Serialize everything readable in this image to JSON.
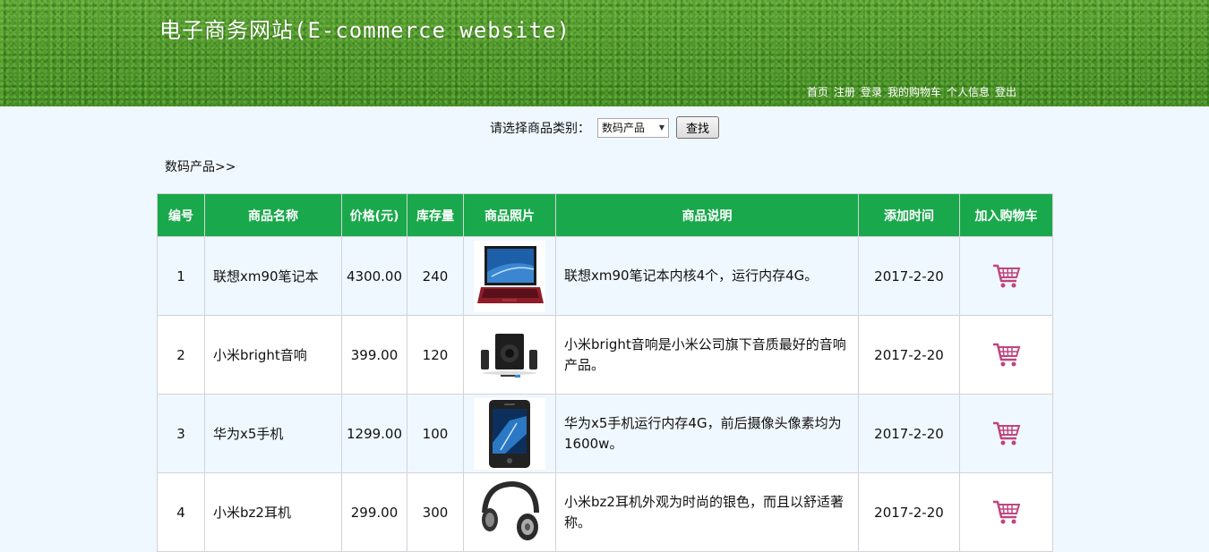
{
  "header": {
    "title": "电子商务网站(E-commerce website)",
    "nav": [
      "首页",
      "注册",
      "登录",
      "我的购物车",
      "个人信息",
      "登出"
    ]
  },
  "filter": {
    "label": "请选择商品类别：",
    "selected": "数码产品",
    "button": "查找"
  },
  "breadcrumb": "数码产品>>",
  "table": {
    "headers": [
      "编号",
      "商品名称",
      "价格(元)",
      "库存量",
      "商品照片",
      "商品说明",
      "添加时间",
      "加入购物车"
    ],
    "rows": [
      {
        "id": "1",
        "name": "联想xm90笔记本",
        "price": "4300.00",
        "stock": "240",
        "image": "laptop-image",
        "desc": "联想xm90笔记本内核4个，运行内存4G。",
        "date": "2017-2-20"
      },
      {
        "id": "2",
        "name": "小米bright音响",
        "price": "399.00",
        "stock": "120",
        "image": "speaker-image",
        "desc": "小米bright音响是小米公司旗下音质最好的音响产品。",
        "date": "2017-2-20"
      },
      {
        "id": "3",
        "name": "华为x5手机",
        "price": "1299.00",
        "stock": "100",
        "image": "phone-image",
        "desc": "华为x5手机运行内存4G，前后摄像头像素均为1600w。",
        "date": "2017-2-20"
      },
      {
        "id": "4",
        "name": "小米bz2耳机",
        "price": "299.00",
        "stock": "300",
        "image": "headphones-image",
        "desc": "小米bz2耳机外观为时尚的银色，而且以舒适著称。",
        "date": "2017-2-20"
      }
    ]
  },
  "colors": {
    "header_green": "#4f9a2c",
    "table_header": "#1aa84c",
    "cart_pink": "#c0457e",
    "page_bg": "#f0f8ff"
  }
}
